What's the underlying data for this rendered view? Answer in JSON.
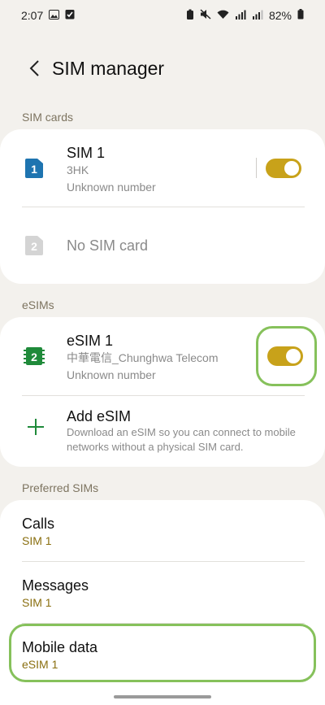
{
  "status_bar": {
    "time": "2:07",
    "battery": "82%"
  },
  "header": {
    "title": "SIM manager"
  },
  "sim_cards": {
    "label": "SIM cards",
    "sim1": {
      "badge": "1",
      "title": "SIM 1",
      "carrier": "3HK",
      "number": "Unknown number",
      "enabled": true
    },
    "sim2": {
      "badge": "2",
      "title": "No SIM card"
    }
  },
  "esims": {
    "label": "eSIMs",
    "esim1": {
      "badge": "2",
      "title": "eSIM 1",
      "carrier": "中華電信_Chunghwa Telecom",
      "number": "Unknown number",
      "enabled": true
    },
    "add": {
      "title": "Add eSIM",
      "description": "Download an eSIM so you can connect to mobile networks without a physical SIM card."
    }
  },
  "preferred": {
    "label": "Preferred SIMs",
    "calls": {
      "title": "Calls",
      "value": "SIM 1"
    },
    "messages": {
      "title": "Messages",
      "value": "SIM 1"
    },
    "mobile_data": {
      "title": "Mobile data",
      "value": "eSIM 1"
    }
  },
  "colors": {
    "background": "#f3f1ed",
    "card": "#ffffff",
    "toggle_on": "#c8a21a",
    "sim1_icon": "#1e74b0",
    "esim_icon": "#1f8a3a",
    "highlight": "#86c15b",
    "value_text": "#8a6f10"
  }
}
